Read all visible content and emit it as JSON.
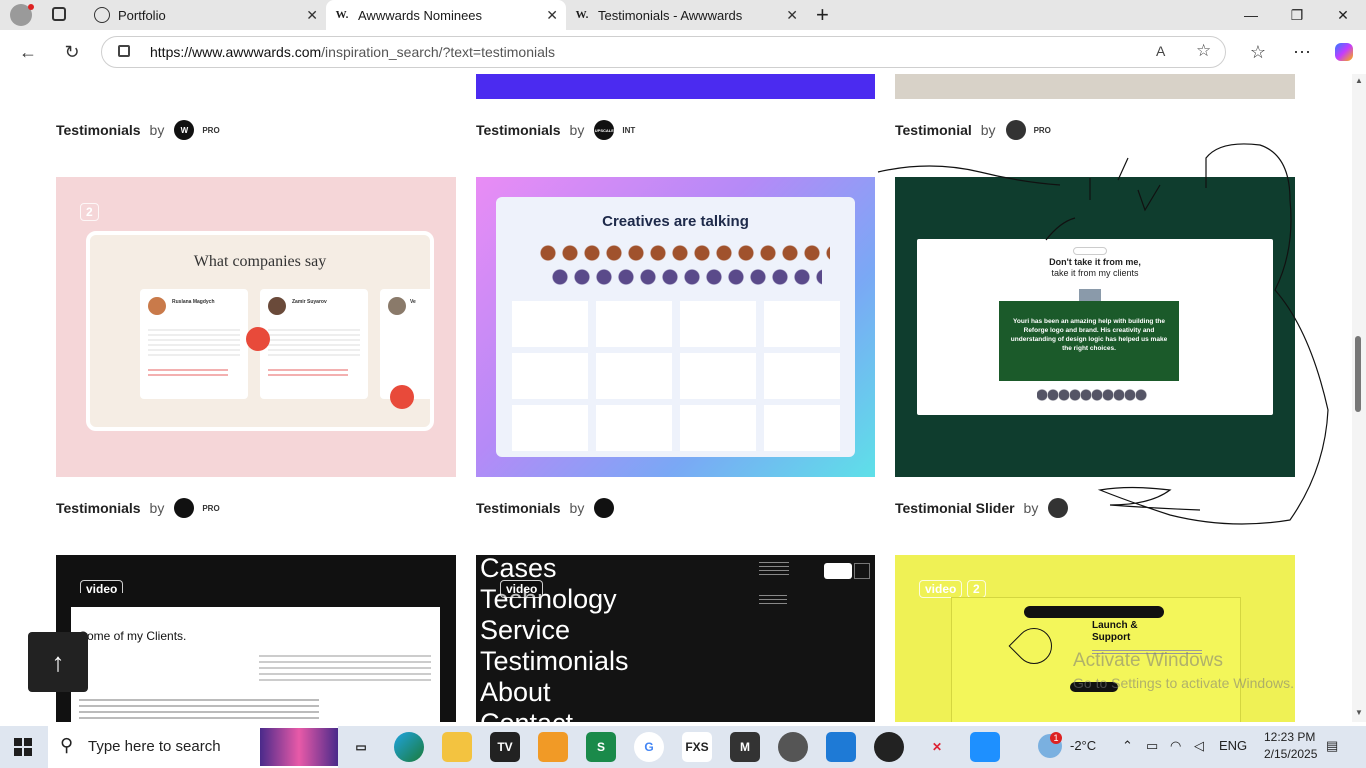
{
  "browser": {
    "tabs": [
      {
        "title": "Portfolio",
        "icon": "globe-icon"
      },
      {
        "title": "Awwwards Nominees",
        "icon": "awwwards-w-icon",
        "active": true
      },
      {
        "title": "Testimonials - Awwwards",
        "icon": "awwwards-w-icon"
      }
    ],
    "new_tab": "+",
    "url_host": "https://www.awwwards.com",
    "url_path": "/inspiration_search/?text=testimonials"
  },
  "gallery": {
    "by_label": "by",
    "row1": [
      {
        "title": "Testimonials",
        "avatar": "W",
        "badge": "PRO"
      },
      {
        "title": "Testimonials",
        "avatar": "UPSCALE",
        "badge": "INT"
      },
      {
        "title": "Testimonial",
        "avatar": "",
        "badge": "PRO"
      }
    ],
    "row2": [
      {
        "title": "Testimonials",
        "avatar": "",
        "badge": "PRO",
        "count": "2",
        "heading": "What companies say",
        "reviewers": [
          "Ruslana Magdych",
          "Zamir Suyarov",
          "Ve"
        ]
      },
      {
        "title": "Testimonials",
        "avatar": "",
        "badge": "",
        "heading": "Creatives are talking"
      },
      {
        "title": "Testimonial Slider",
        "avatar": "",
        "badge": "",
        "heading_line1": "Don't take it from me,",
        "heading_line2": "take it from my clients",
        "quote": "Youri has been an amazing help with building the Reforge logo and brand. His creativity and understanding of design logic has helped us make the right choices."
      }
    ],
    "row3": [
      {
        "tag": "video",
        "heading": "Some of my Clients."
      },
      {
        "tag": "video",
        "menu": [
          "Cases",
          "Technology",
          "Service",
          "Testimonials",
          "About",
          "Contact"
        ]
      },
      {
        "tag": "video",
        "count": "2",
        "heading": "Launch & Support"
      }
    ]
  },
  "watermark": {
    "line1": "Activate Windows",
    "line2": "Go to Settings to activate Windows."
  },
  "taskbar": {
    "search_placeholder": "Type here to search",
    "weather": "-2°C",
    "language": "ENG",
    "time": "12:23 PM",
    "date": "2/15/2025",
    "notification_count": "1"
  },
  "colors": {
    "accent_purple": "#4b2bf0",
    "card_pink": "#f5d6d8",
    "card_green": "#0f3d2e",
    "card_yellow": "#eff155"
  }
}
